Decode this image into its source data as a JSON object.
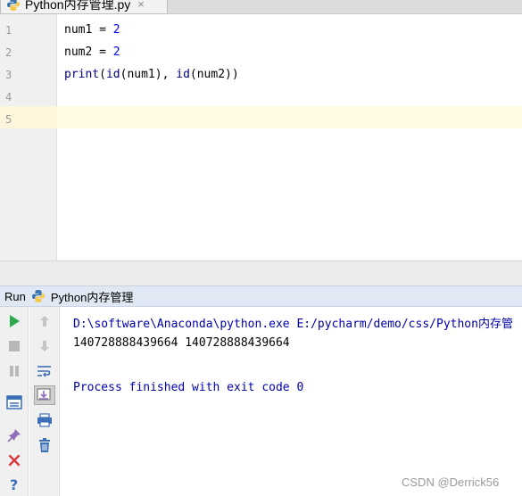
{
  "tab": {
    "title": "Python内存管理.py",
    "close": "×",
    "icon": "python-file-icon"
  },
  "editor": {
    "line_numbers": [
      "1",
      "2",
      "3",
      "4",
      "5"
    ],
    "lines": {
      "l1_name": "num1",
      "l1_op": " = ",
      "l1_val": "2",
      "l2_name": "num2",
      "l2_op": " = ",
      "l2_val": "2",
      "l3_print": "print",
      "l3_open": "(",
      "l3_id1": "id",
      "l3_arg1": "(num1), ",
      "l3_id2": "id",
      "l3_arg2": "(num2))"
    }
  },
  "run": {
    "label": "Run",
    "config": "Python内存管理",
    "icon": "python-icon"
  },
  "console": {
    "command": "D:\\software\\Anaconda\\python.exe E:/pycharm/demo/css/Python内存管",
    "output": "140728888439664 140728888439664",
    "exit": "Process finished with exit code 0"
  },
  "watermark": "CSDN @Derrick56",
  "colors": {
    "number": "#0000ff",
    "console_info": "#0000aa",
    "run_bar": "#dfe8f3",
    "caret_row": "#fffae3"
  }
}
